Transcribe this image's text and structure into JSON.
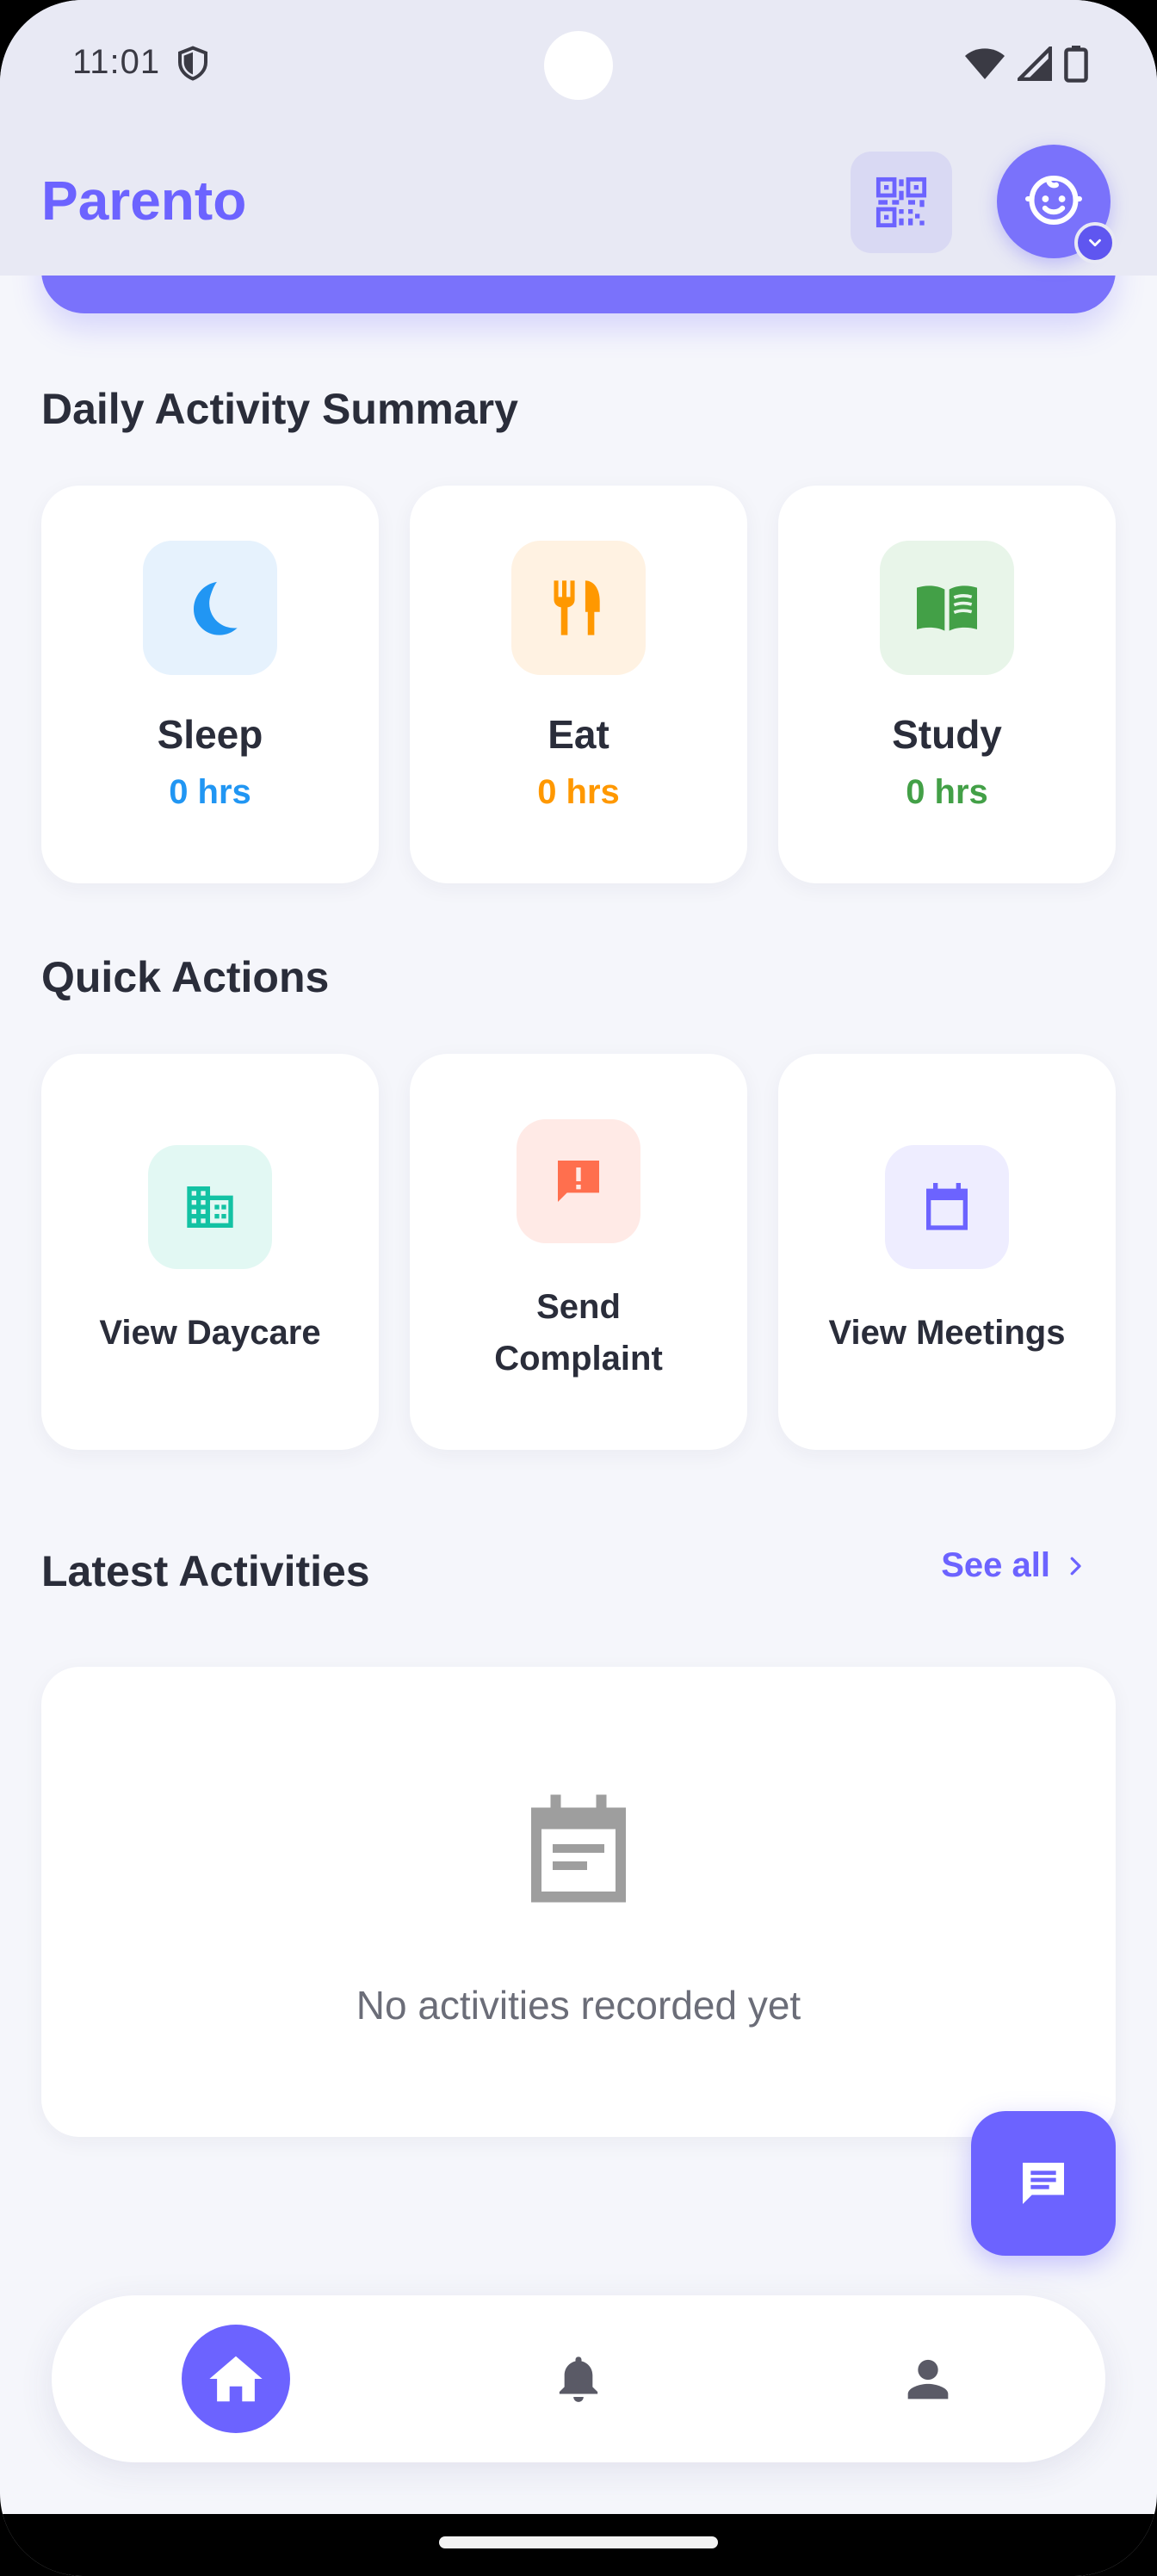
{
  "status_bar": {
    "time": "11:01"
  },
  "app_bar": {
    "title": "Parento",
    "qr_icon": "qr-code-icon",
    "avatar_icon": "child-face-icon"
  },
  "daily_summary": {
    "title": "Daily Activity Summary",
    "cards": [
      {
        "label": "Sleep",
        "value": "0 hrs",
        "icon": "moon-icon",
        "color": "#2196f3",
        "bg": "#e6f2fd"
      },
      {
        "label": "Eat",
        "value": "0 hrs",
        "icon": "fork-knife-icon",
        "color": "#ff9800",
        "bg": "#fff2e2"
      },
      {
        "label": "Study",
        "value": "0 hrs",
        "icon": "book-icon",
        "color": "#43a047",
        "bg": "#e8f5e9"
      }
    ]
  },
  "quick_actions": {
    "title": "Quick Actions",
    "items": [
      {
        "label": "View Daycare",
        "icon": "building-icon",
        "color": "#13c2a3",
        "bg": "#e2f8f3"
      },
      {
        "label": "Send Complaint",
        "icon": "report-chat-icon",
        "color": "#ff6f4e",
        "bg": "#ffeae6"
      },
      {
        "label": "View Meetings",
        "icon": "calendar-icon",
        "color": "#6c63ff",
        "bg": "#eeedff"
      }
    ]
  },
  "latest_activities": {
    "title": "Latest Activities",
    "see_all": "See all",
    "empty_text": "No activities recorded yet"
  },
  "bottom_nav": {
    "items": [
      "home-icon",
      "bell-icon",
      "person-icon"
    ],
    "active": "home-icon"
  },
  "colors": {
    "accent": "#6c63ff",
    "background": "#f5f6fb"
  }
}
